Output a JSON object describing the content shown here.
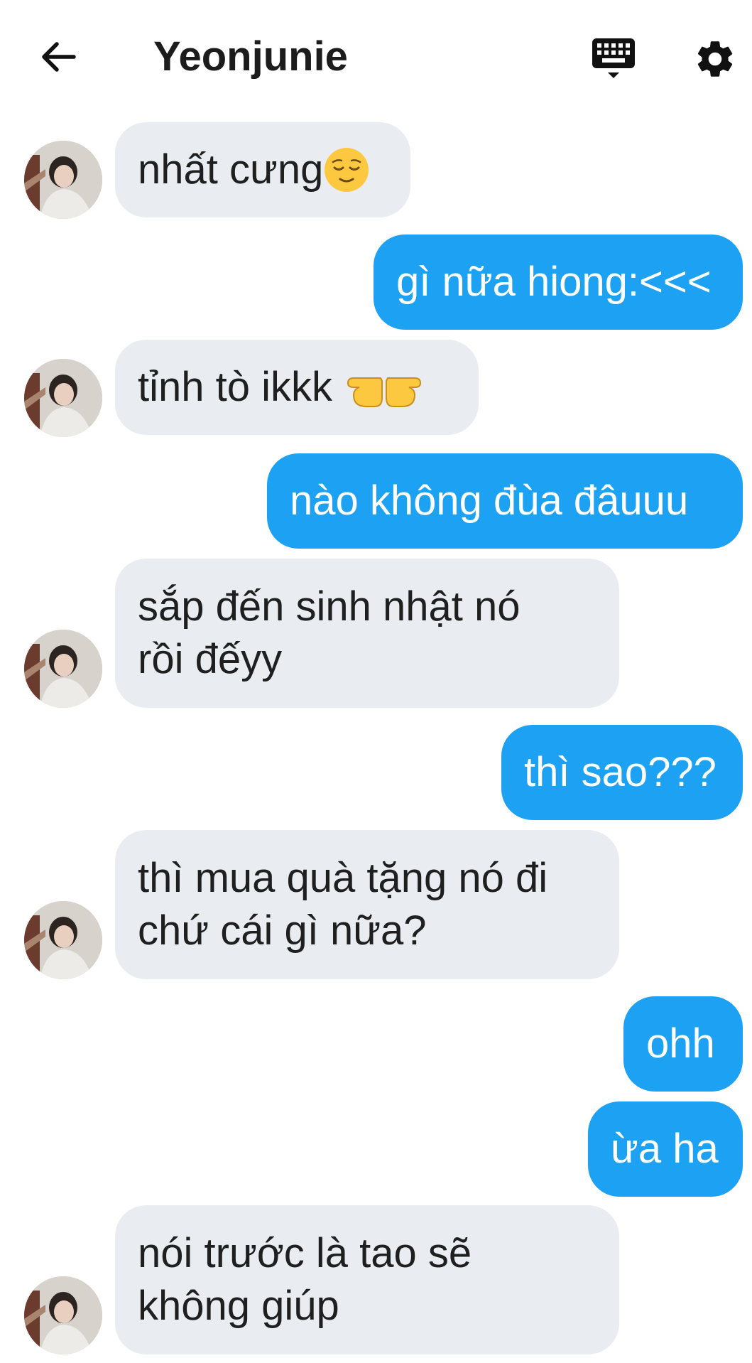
{
  "header": {
    "title": "Yeonjunie",
    "back_icon": "arrow-left-icon",
    "keyboard_icon": "keyboard-icon",
    "settings_icon": "gear-icon"
  },
  "colors": {
    "sent_bubble": "#1da1f2",
    "received_bubble": "#e9ecf0"
  },
  "messages": [
    {
      "side": "received",
      "text": "nhất cưng",
      "emoji": "relieved-face"
    },
    {
      "side": "sent",
      "text": "gì nữa hiong:<<<"
    },
    {
      "side": "received",
      "text": "tỉnh tò ikkk",
      "emoji": "pointing-hands"
    },
    {
      "side": "sent",
      "text": "nào không đùa đâuuu"
    },
    {
      "side": "received",
      "lines": [
        "sắp đến sinh nhật nó",
        "rồi đếyy"
      ]
    },
    {
      "side": "sent",
      "text": "thì sao???"
    },
    {
      "side": "received",
      "lines": [
        "thì mua quà tặng nó đi",
        "chứ cái gì nữa?"
      ]
    },
    {
      "side": "sent",
      "text": "ohh"
    },
    {
      "side": "sent",
      "text": "ừa ha"
    },
    {
      "side": "received",
      "lines": [
        "nói trước là tao sẽ",
        "không giúp"
      ]
    }
  ]
}
